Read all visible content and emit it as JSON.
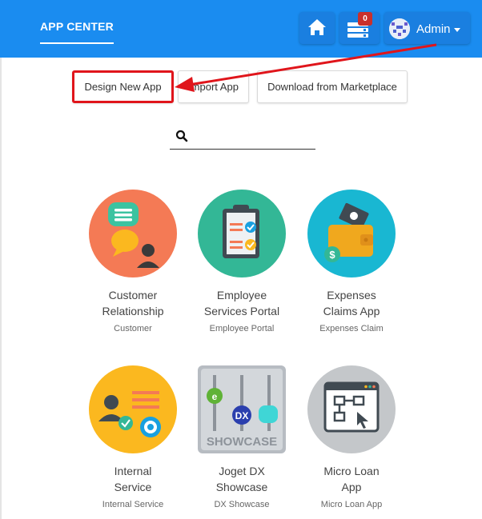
{
  "header": {
    "brand": "APP CENTER",
    "notification_count": "0",
    "user_label": "Admin"
  },
  "actions": {
    "design": "Design New App",
    "import": "Import App",
    "marketplace": "Download from Marketplace"
  },
  "search": {
    "placeholder": ""
  },
  "apps": [
    {
      "name_line1": "Customer",
      "name_line2": "Relationship",
      "sub": "Customer",
      "icon": "customer-relationship-icon",
      "color": "#f47a55"
    },
    {
      "name_line1": "Employee",
      "name_line2": "Services Portal",
      "sub": "Employee Portal",
      "icon": "employee-portal-icon",
      "color": "#33b796"
    },
    {
      "name_line1": "Expenses",
      "name_line2": "Claims App",
      "sub": "Expenses Claim",
      "icon": "expenses-claim-icon",
      "color": "#19b7d2"
    },
    {
      "name_line1": "Internal",
      "name_line2": "Service",
      "sub": "Internal Service",
      "icon": "internal-service-icon",
      "color": "#fbb81f"
    },
    {
      "name_line1": "Joget DX",
      "name_line2": "Showcase",
      "sub": "DX Showcase",
      "icon": "showcase-icon",
      "color": "#c9ced4"
    },
    {
      "name_line1": "Micro Loan",
      "name_line2": "App",
      "sub": "Micro Loan App",
      "icon": "micro-loan-icon",
      "color": "#c4c7ca"
    }
  ],
  "colors": {
    "header_bg": "#1a8cf0",
    "highlight": "#e0151b"
  }
}
